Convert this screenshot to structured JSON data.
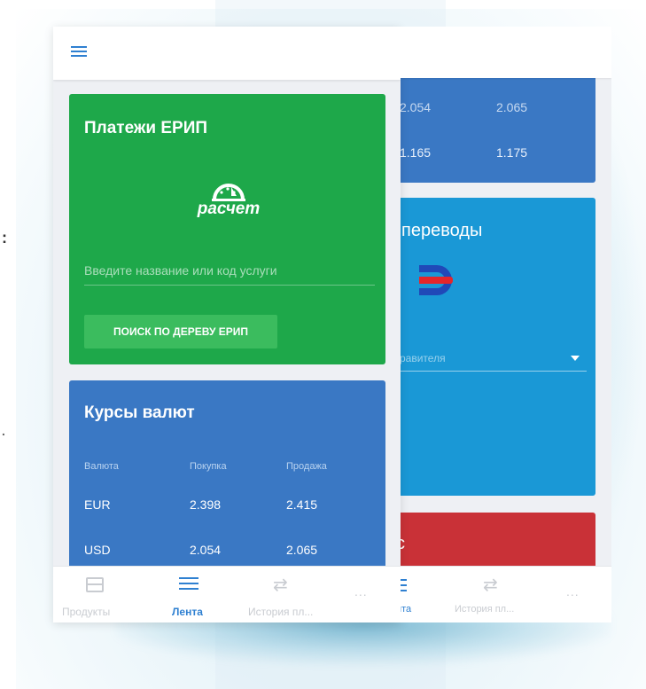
{
  "edge_marks": [
    ":",
    "."
  ],
  "front": {
    "erip": {
      "title": "Платежи ЕРИП",
      "logo_text": "расчет",
      "search_placeholder": "Введите название или код услуги",
      "tree_button": "ПОИСК ПО ДЕРЕВУ ЕРИП"
    },
    "rates": {
      "title": "Курсы валют",
      "headers": [
        "Валюта",
        "Покупка",
        "Продажа"
      ],
      "rows": [
        {
          "currency": "EUR",
          "buy": "2.398",
          "sell": "2.415"
        },
        {
          "currency": "USD",
          "buy": "2.054",
          "sell": "2.065"
        }
      ]
    },
    "nav": [
      {
        "label": "Продукты",
        "active": false
      },
      {
        "label": "Лента",
        "active": true
      },
      {
        "label": "История пл...",
        "active": false
      },
      {
        "label": "...",
        "active": false
      }
    ]
  },
  "back": {
    "rates_rows": [
      {
        "buy": "2.054",
        "sell": "2.065"
      },
      {
        "buy": "1.165",
        "sell": "1.175"
      }
    ],
    "transfer_title": "переводы",
    "select_placeholder": "равителя",
    "red_card_char": "с",
    "nav": [
      {
        "label": "нта",
        "active": true
      },
      {
        "label": "История пл...",
        "active": false
      },
      {
        "label": "...",
        "active": false
      }
    ]
  },
  "colors": {
    "erip_green": "#1ea84a",
    "erip_button_green": "#3bbc5e",
    "rates_blue": "#3a78c4",
    "transfer_blue": "#1a98d6",
    "red": "#c93137",
    "accent": "#2f80d1",
    "nav_inactive": "#c9ccd1"
  }
}
